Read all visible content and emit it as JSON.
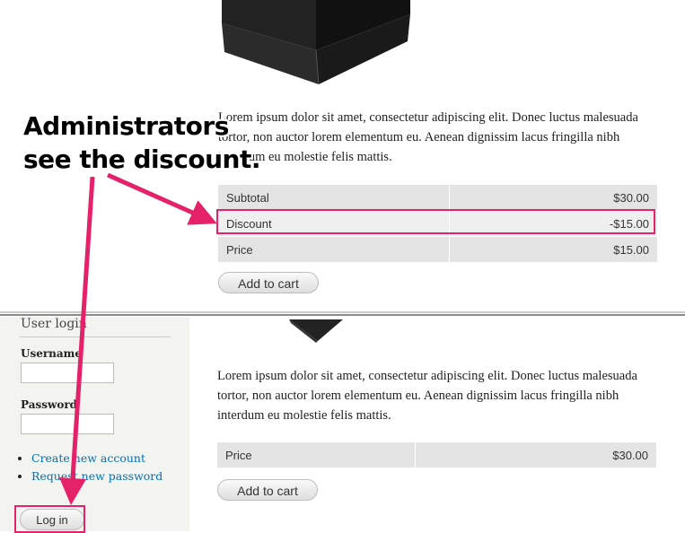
{
  "annotation": {
    "line1": "Administrators",
    "line2": "see the discount."
  },
  "admin_view": {
    "description": "Lorem ipsum dolor sit amet, consectetur adipiscing elit. Donec luctus malesuada tortor, non auctor lorem elementum eu. Aenean dignissim lacus fringilla nibh interdum eu molestie felis mattis.",
    "price_rows": [
      {
        "label": "Subtotal",
        "value": "$30.00"
      },
      {
        "label": "Discount",
        "value": "-$15.00"
      },
      {
        "label": "Price",
        "value": "$15.00"
      }
    ],
    "add_to_cart": "Add to cart"
  },
  "anonymous_view": {
    "sidebar": {
      "title": "User login",
      "username_label": "Username",
      "password_label": "Password",
      "links": [
        "Create new account",
        "Request new password"
      ],
      "login_button": "Log in"
    },
    "description": "Lorem ipsum dolor sit amet, consectetur adipiscing elit. Donec luctus malesuada tortor, non auctor lorem elementum eu. Aenean dignissim lacus fringilla nibh interdum eu molestie felis mattis.",
    "price_rows": [
      {
        "label": "Price",
        "value": "$30.00"
      }
    ],
    "add_to_cart": "Add to cart"
  },
  "colors": {
    "highlight": "#e5216a",
    "link": "#0071b3"
  }
}
